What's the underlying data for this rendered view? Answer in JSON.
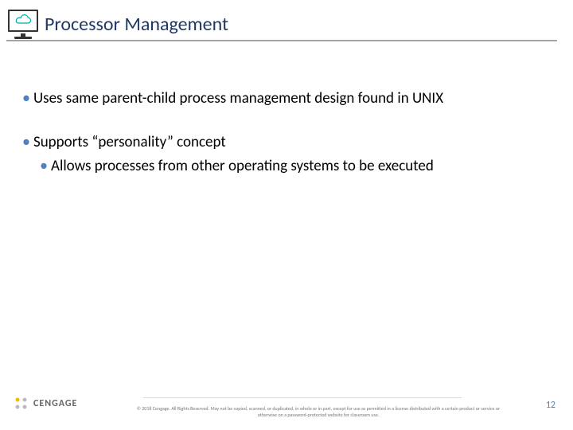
{
  "header": {
    "title": "Processor Management",
    "icon_name": "cloud-monitor-icon"
  },
  "bullets": [
    {
      "level": 1,
      "text": "Uses same parent-child process management design found in UNIX"
    },
    {
      "level": 1,
      "text": "Supports “personality” concept"
    },
    {
      "level": 2,
      "text": "Allows processes from other operating systems to be executed"
    }
  ],
  "footer": {
    "logo_text": "CENGAGE",
    "copyright": "© 2018 Cengage. All Rights Reserved. May not be copied, scanned, or duplicated, in whole or in part, except for use as permitted in a license distributed with a certain product or service or otherwise on a password-protected website for classroom use.",
    "page_number": "12"
  }
}
